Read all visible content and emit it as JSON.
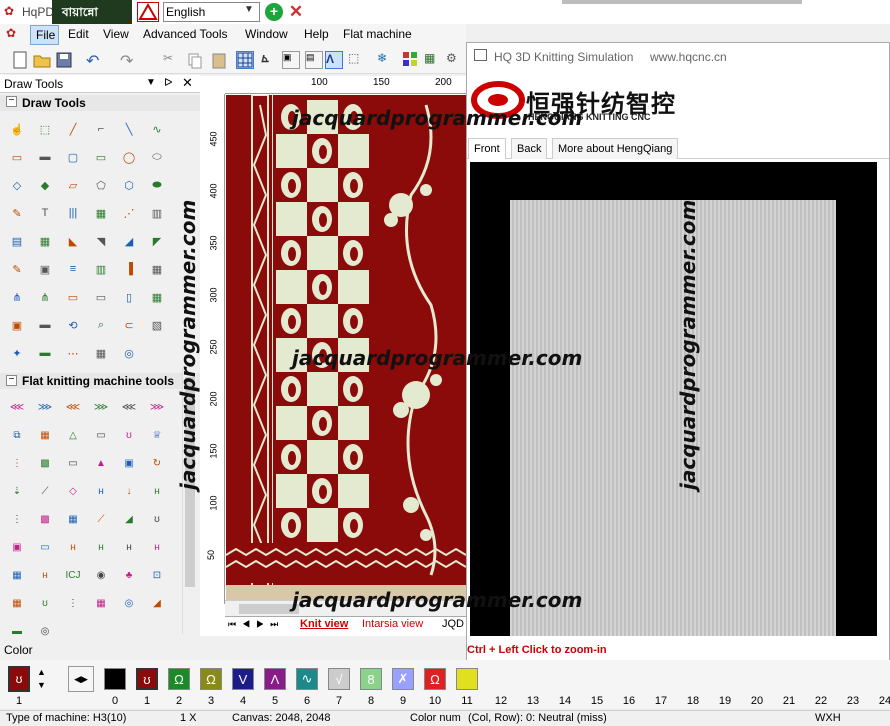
{
  "app": {
    "title": "HqPD",
    "language_label": "বায়ান্নো",
    "language": "English"
  },
  "menu": [
    "File",
    "Edit",
    "View",
    "Advanced Tools",
    "Window",
    "Help",
    "Flat machine"
  ],
  "panel": {
    "title": "Draw Tools",
    "sections": [
      "Draw Tools",
      "Flat knitting machine tools"
    ]
  },
  "ruler": {
    "top_ticks": [
      "100",
      "150",
      "200"
    ],
    "left_ticks": [
      "450",
      "400",
      "350",
      "300",
      "250",
      "200",
      "150",
      "100",
      "50"
    ]
  },
  "tabs": [
    "Knit view",
    "Intarsia view",
    "JQD"
  ],
  "sim": {
    "title": "HQ 3D Knitting Simulation",
    "url": "www.hqcnc.cn",
    "brand_cn": "恒强针纺智控",
    "brand_en": "HENGQIANG KNITTING CNC",
    "tabs": [
      "Front",
      "Back",
      "More about HengQiang"
    ],
    "hint": "Ctrl + Left Click to zoom-in"
  },
  "watermark": "jacquardprogrammer.com",
  "color_panel_title": "Color",
  "swatches": [
    {
      "n": "0",
      "c": "#000000",
      "g": ""
    },
    {
      "n": "1",
      "c": "#8b0a0a",
      "g": "ʊ"
    },
    {
      "n": "2",
      "c": "#1c8a2a",
      "g": "Ω"
    },
    {
      "n": "3",
      "c": "#8a8a1c",
      "g": "Ω"
    },
    {
      "n": "4",
      "c": "#1c1c8a",
      "g": "V"
    },
    {
      "n": "5",
      "c": "#8a1c8a",
      "g": "Λ"
    },
    {
      "n": "6",
      "c": "#1c8a8a",
      "g": "∿"
    },
    {
      "n": "7",
      "c": "#cccccc",
      "g": "√"
    },
    {
      "n": "8",
      "c": "#8bd28b",
      "g": "8"
    },
    {
      "n": "9",
      "c": "#9aa0ff",
      "g": "✗"
    },
    {
      "n": "10",
      "c": "#e02020",
      "g": "Ω"
    },
    {
      "n": "11",
      "c": "#e0e020",
      "g": ""
    }
  ],
  "extra_color_nums": [
    "12",
    "13",
    "14",
    "15",
    "16",
    "17",
    "18",
    "19",
    "20",
    "21",
    "22",
    "23",
    "24"
  ],
  "status": {
    "machine": "Type of machine: H3(10)",
    "zoom": "1 X",
    "canvas": "Canvas: 2048, 2048",
    "colornum": "Color num",
    "colrow": "(Col, Row): 0: Neutral (miss)",
    "wxh": "WXH"
  },
  "colors": {
    "design_red": "#8b0a0a",
    "design_cream": "#e4ead0",
    "accent_blue": "#7aa7d8"
  }
}
